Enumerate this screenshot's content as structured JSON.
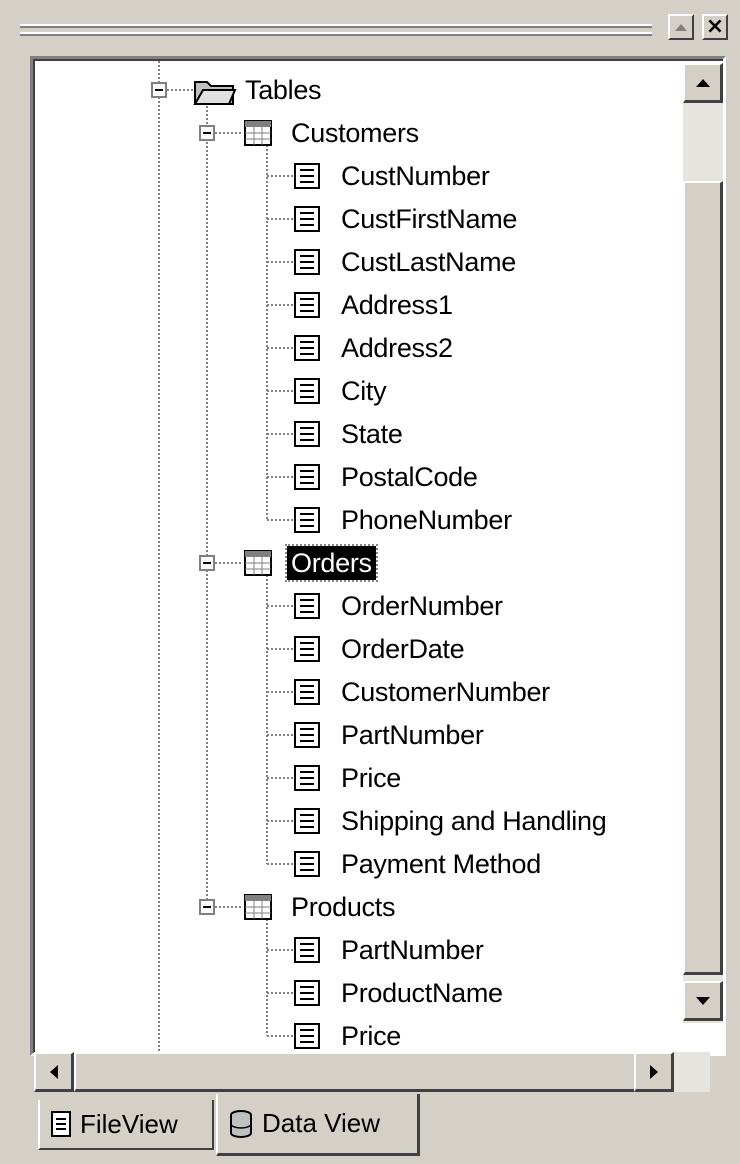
{
  "window": {
    "minimize_icon": "triangle-up-icon",
    "close_glyph": "×"
  },
  "tree": {
    "root": {
      "label": "Tables",
      "icon": "folder-open-icon",
      "expanded": true
    },
    "tables": [
      {
        "label": "Customers",
        "icon": "table-icon",
        "expanded": true,
        "selected": false,
        "fields": [
          "CustNumber",
          "CustFirstName",
          "CustLastName",
          "Address1",
          "Address2",
          "City",
          "State",
          "PostalCode",
          "PhoneNumber"
        ]
      },
      {
        "label": "Orders",
        "icon": "table-icon",
        "expanded": true,
        "selected": true,
        "fields": [
          "OrderNumber",
          "OrderDate",
          "CustomerNumber",
          "PartNumber",
          "Price",
          "Shipping and Handling",
          "Payment Method"
        ]
      },
      {
        "label": "Products",
        "icon": "table-icon",
        "expanded": true,
        "selected": false,
        "fields": [
          "PartNumber",
          "ProductName",
          "Price"
        ]
      }
    ],
    "field_icon": "field-icon"
  },
  "tabs": [
    {
      "label": "FileView",
      "icon": "document-icon",
      "active": false
    },
    {
      "label": "Data View",
      "icon": "database-icon",
      "active": true
    }
  ]
}
